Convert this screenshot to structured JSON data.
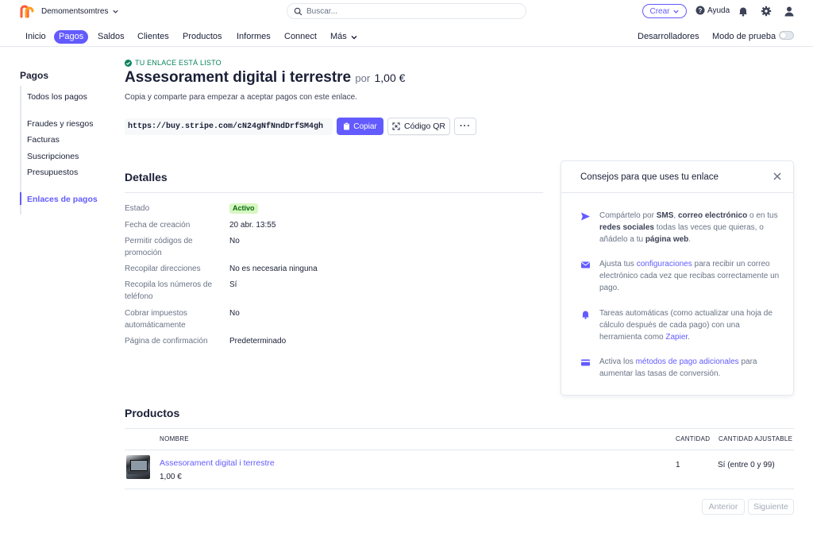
{
  "topbar": {
    "account_name": "Demomentsomtres",
    "search_placeholder": "Buscar...",
    "create_label": "Crear",
    "help_label": "Ayuda"
  },
  "nav": {
    "items": [
      "Inicio",
      "Pagos",
      "Saldos",
      "Clientes",
      "Productos",
      "Informes",
      "Connect",
      "Más"
    ],
    "active": "Pagos",
    "developers": "Desarrolladores",
    "test_mode": "Modo de prueba",
    "test_mode_on": false
  },
  "sidebar": {
    "title": "Pagos",
    "items": [
      "Todos los pagos",
      "Fraudes y riesgos",
      "Facturas",
      "Suscripciones",
      "Presupuestos",
      "Enlaces de pagos"
    ],
    "active": "Enlaces de pagos"
  },
  "header": {
    "ready_text": "TU ENLACE ESTÁ LISTO",
    "title": "Assesorament digital i terrestre",
    "por": "por",
    "price": "1,00 €",
    "subtitle": "Copia y comparte para empezar a aceptar pagos con este enlace.",
    "link": "https://buy.stripe.com/cN24gNfNndDrfSM4gh",
    "copy_label": "Copiar",
    "qr_label": "Código QR",
    "more_label": "···"
  },
  "details": {
    "title": "Detalles",
    "rows": [
      {
        "label": "Estado",
        "value": "Activo"
      },
      {
        "label": "Fecha de creación",
        "value": "20 abr. 13:55"
      },
      {
        "label": "Permitir códigos de promoción",
        "value": "No"
      },
      {
        "label": "Recopilar direcciones",
        "value": "No es necesaria ninguna"
      },
      {
        "label": "Recopila los números de teléfono",
        "value": "Sí"
      },
      {
        "label": "Cobrar impuestos automáticamente",
        "value": "No"
      },
      {
        "label": "Página de confirmación",
        "value": "Predeterminado"
      }
    ]
  },
  "tips": {
    "title": "Consejos para que uses tu enlace",
    "items": [
      {
        "icon": "send-icon",
        "parts": [
          {
            "t": "Compártelo por "
          },
          {
            "t": "SMS",
            "s": "hl"
          },
          {
            "t": ", "
          },
          {
            "t": "correo electrónico",
            "s": "hl"
          },
          {
            "t": " o en tus "
          },
          {
            "t": "redes sociales",
            "s": "hl"
          },
          {
            "t": " todas las veces que quieras, o añádelo a tu "
          },
          {
            "t": "página web",
            "s": "hl"
          },
          {
            "t": "."
          }
        ]
      },
      {
        "icon": "mail-icon",
        "parts": [
          {
            "t": "Ajusta tus "
          },
          {
            "t": "configuraciones",
            "s": "lk"
          },
          {
            "t": " para recibir un correo electrónico cada vez que recibas correctamente un pago."
          }
        ]
      },
      {
        "icon": "bell-icon",
        "parts": [
          {
            "t": "Tareas automáticas (como actualizar una hoja de cálculo después de cada pago) con una herramienta como "
          },
          {
            "t": "Zapier",
            "s": "lk"
          },
          {
            "t": "."
          }
        ]
      },
      {
        "icon": "card-icon",
        "parts": [
          {
            "t": "Activa los "
          },
          {
            "t": "métodos de pago adicionales",
            "s": "lk"
          },
          {
            "t": " para aumentar las tasas de conversión."
          }
        ]
      }
    ]
  },
  "products": {
    "title": "Productos",
    "col_name": "NOMBRE",
    "col_qty": "CANTIDAD",
    "col_adj": "CANTIDAD AJUSTABLE",
    "rows": [
      {
        "name": "Assesorament digital i terrestre",
        "price": "1,00 €",
        "qty": "1",
        "adjustable": "Sí (entre 0 y 99)"
      }
    ],
    "prev_label": "Anterior",
    "next_label": "Siguiente"
  },
  "colors": {
    "accent": "#635bff",
    "success": "#09825d",
    "badge_bg": "#d7f7c2"
  }
}
